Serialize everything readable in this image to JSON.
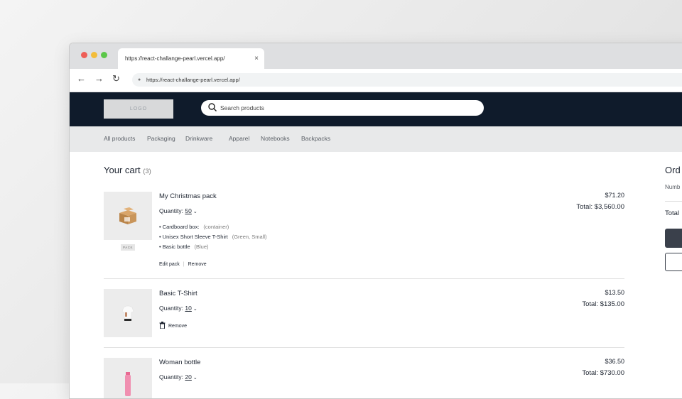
{
  "browser": {
    "tab_title": "https://react-challange-pearl.vercel.app/",
    "tab_close": "×",
    "url": "https://react-challange-pearl.vercel.app/"
  },
  "header": {
    "logo": "LOGO",
    "search_placeholder": "Search products"
  },
  "categories": [
    "All products",
    "Packaging",
    "Drinkware",
    "Apparel",
    "Notebooks",
    "Backpacks"
  ],
  "cart": {
    "title": "Your cart",
    "count": "(3)",
    "items": [
      {
        "name": "My Christmas pack",
        "quantity_label": "Quantity:",
        "quantity": "50",
        "price": "$71.20",
        "total": "Total: $3,560.00",
        "tag": "PACK",
        "contents": [
          {
            "name": "Cardboard box:",
            "note": "(container)"
          },
          {
            "name": "Unisex Short Sleeve T-Shirt",
            "note": "(Green, Small)"
          },
          {
            "name": "Basic bottle",
            "note": "(Blue)"
          }
        ],
        "edit_label": "Edit pack",
        "remove_label": "Remove"
      },
      {
        "name": "Basic T-Shirt",
        "quantity_label": "Quantity:",
        "quantity": "10",
        "price": "$13.50",
        "total": "Total: $135.00",
        "remove_label": "Remove"
      },
      {
        "name": "Woman bottle",
        "quantity_label": "Quantity:",
        "quantity": "20",
        "price": "$36.50",
        "total": "Total: $730.00"
      }
    ]
  },
  "summary": {
    "title": "Ord",
    "number_label": "Numb",
    "total_label": "Total"
  },
  "colors": {
    "header_bg": "#0f1b2b",
    "nav_bg": "#e8e9ea",
    "primary_button": "#3a404b"
  }
}
